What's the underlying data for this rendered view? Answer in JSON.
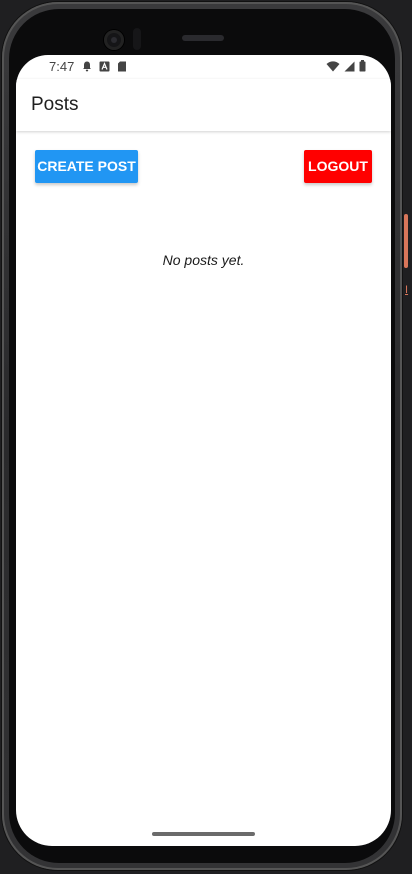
{
  "status_bar": {
    "time": "7:47",
    "left_icons": [
      "bell-icon",
      "a-icon",
      "sd-card-icon"
    ],
    "right_icons": [
      "wifi-icon",
      "signal-icon",
      "battery-icon"
    ]
  },
  "app_bar": {
    "title": "Posts"
  },
  "actions": {
    "create_label": "CREATE POST",
    "logout_label": "LOGOUT"
  },
  "colors": {
    "create_button": "#2196f3",
    "logout_button": "#ff0000"
  },
  "main": {
    "empty_message": "No posts yet."
  }
}
